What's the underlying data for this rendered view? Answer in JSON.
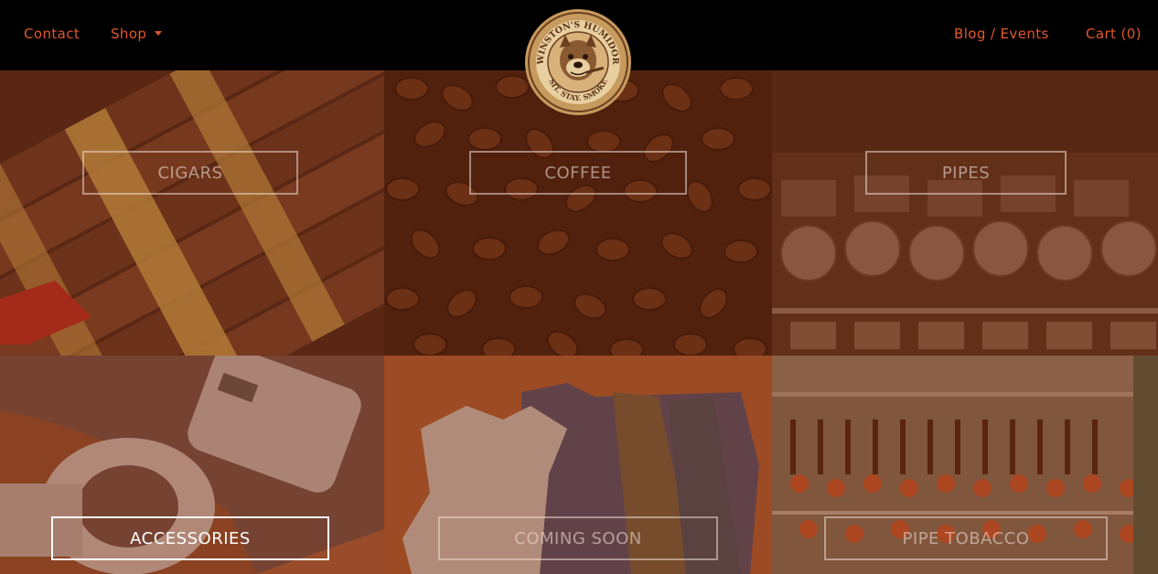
{
  "nav": {
    "contact": "Contact",
    "shop": "Shop",
    "blog": "Blog / Events",
    "cart": "Cart (0)"
  },
  "logo": {
    "top_text": "WINSTON'S HUMIDOR",
    "bottom_text": "SIT. STAY. SMOKE"
  },
  "categories": [
    {
      "label": "CIGARS",
      "active": false
    },
    {
      "label": "COFFEE",
      "active": false
    },
    {
      "label": "PIPES",
      "active": false
    },
    {
      "label": "ACCESSORIES",
      "active": true
    },
    {
      "label": "COMING SOON",
      "active": false
    },
    {
      "label": "PIPE TOBACCO",
      "active": false
    }
  ],
  "colors": {
    "nav_accent": "#e2572c",
    "overlay": "#8c3714",
    "logo_ring": "#c79a5d"
  }
}
